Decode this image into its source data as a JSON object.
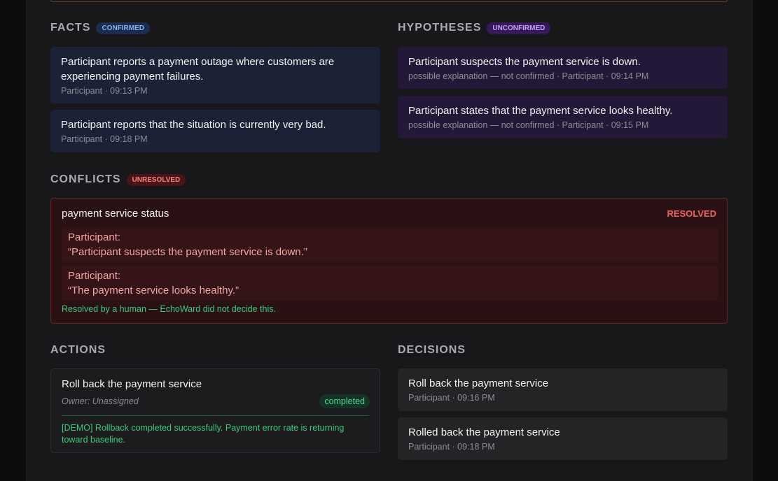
{
  "facts": {
    "heading": "FACTS",
    "badge": "CONFIRMED",
    "items": [
      {
        "text": "Participant reports a payment outage where customers are experiencing payment failures.",
        "meta": "Participant · 09:13 PM"
      },
      {
        "text": "Participant reports that the situation is currently very bad.",
        "meta": "Participant · 09:18 PM"
      }
    ]
  },
  "hypotheses": {
    "heading": "HYPOTHESES",
    "badge": "UNCONFIRMED",
    "items": [
      {
        "text": "Participant suspects the payment service is down.",
        "meta": "possible explanation — not confirmed · Participant · 09:14 PM"
      },
      {
        "text": "Participant states that the payment service looks healthy.",
        "meta": "possible explanation — not confirmed · Participant · 09:15 PM"
      }
    ]
  },
  "conflicts": {
    "heading": "CONFLICTS",
    "badge": "UNRESOLVED",
    "item": {
      "topic": "payment service status",
      "status": "RESOLVED",
      "quotes": [
        {
          "speaker": "Participant:",
          "text": "“Participant suspects the payment service is down.”"
        },
        {
          "speaker": "Participant:",
          "text": "“The payment service looks healthy.”"
        }
      ],
      "note": "Resolved by a human — EchoWard did not decide this."
    }
  },
  "actions": {
    "heading": "ACTIONS",
    "items": [
      {
        "title": "Roll back the payment service",
        "owner": "Owner: Unassigned",
        "status": "completed",
        "result": "[DEMO] Rollback completed successfully. Payment error rate is returning toward baseline."
      }
    ]
  },
  "decisions": {
    "heading": "DECISIONS",
    "items": [
      {
        "text": "Roll back the payment service",
        "meta": "Participant · 09:16 PM"
      },
      {
        "text": "Rolled back the payment service",
        "meta": "Participant · 09:18 PM"
      }
    ]
  }
}
